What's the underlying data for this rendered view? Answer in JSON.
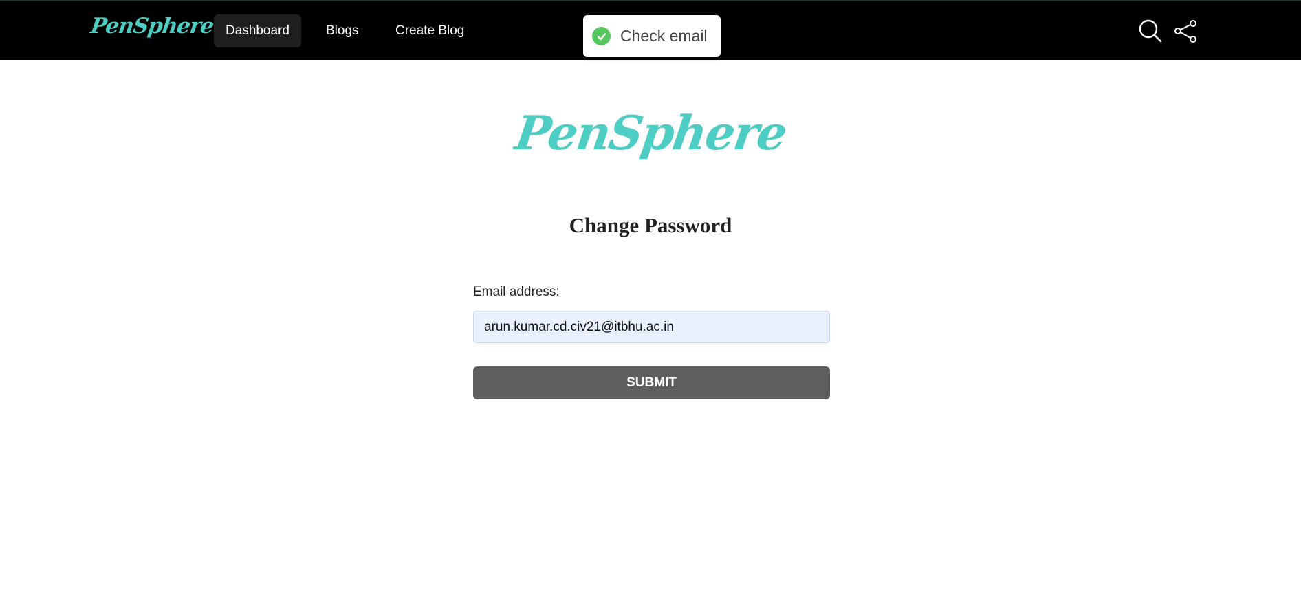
{
  "app": {
    "logo_text": "PenSphere"
  },
  "nav": {
    "links": [
      {
        "label": "Dashboard",
        "active": true
      },
      {
        "label": "Blogs",
        "active": false
      },
      {
        "label": "Create Blog",
        "active": false
      }
    ],
    "icons": [
      "search-icon",
      "share-icon"
    ]
  },
  "toast": {
    "message": "Check email",
    "status": "success",
    "icon": "check-circle-icon",
    "color": "#58c65e"
  },
  "hero": {
    "logo_text": "PenSphere"
  },
  "form": {
    "title": "Change Password",
    "email_label": "Email address:",
    "email_value": "arun.kumar.cd.civ21@itbhu.ac.in",
    "submit_label": "SUBMIT"
  },
  "colors": {
    "brand": "#4ecdc4",
    "navbar_bg": "#000000",
    "button_bg": "#5f5f5f",
    "input_bg": "#e8f0fe"
  }
}
